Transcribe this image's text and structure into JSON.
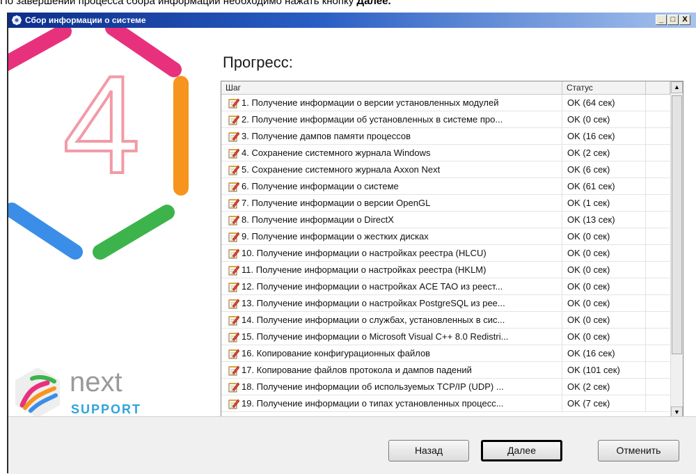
{
  "caption": {
    "text": "По завершении процесса сбора информации необходимо нажать кнопку ",
    "bold": "Далее."
  },
  "window": {
    "title": "Сбор информации о системе",
    "minimize": "_",
    "maximize": "□",
    "close": "X"
  },
  "sidebar": {
    "logo_word": "next",
    "logo_sub": "SUPPORT",
    "big_number": "4"
  },
  "progress": {
    "title": "Прогресс:"
  },
  "table": {
    "headers": {
      "step": "Шаг",
      "status": "Статус"
    },
    "rows": [
      {
        "step": "1. Получение информации о версии установленных модулей",
        "status": "OK (64 сек)"
      },
      {
        "step": "2. Получение информации об установленных в системе про...",
        "status": "OK (0 сек)"
      },
      {
        "step": "3. Получение дампов памяти процессов",
        "status": "OK (16 сек)"
      },
      {
        "step": "4. Сохранение системного журнала Windows",
        "status": "OK (2 сек)"
      },
      {
        "step": "5. Сохранение системного журнала Axxon Next",
        "status": "OK (6 сек)"
      },
      {
        "step": "6. Получение информации о системе",
        "status": "OK (61 сек)"
      },
      {
        "step": "7. Получение информации о версии OpenGL",
        "status": "OK (1 сек)"
      },
      {
        "step": "8. Получение информации о DirectX",
        "status": "OK (13 сек)"
      },
      {
        "step": "9. Получение информации о жестких дисках",
        "status": "OK (0 сек)"
      },
      {
        "step": "10. Получение информации о настройках реестра (HLCU)",
        "status": "OK (0 сек)"
      },
      {
        "step": "11. Получение информации о настройках реестра (HKLM)",
        "status": "OK (0 сек)"
      },
      {
        "step": "12. Получение информации о настройках ACE TAO из реест...",
        "status": "OK (0 сек)"
      },
      {
        "step": "13. Получение информации о настройках PostgreSQL из рее...",
        "status": "OK (0 сек)"
      },
      {
        "step": "14. Получение информации о службах, установленных в сис...",
        "status": "OK (0 сек)"
      },
      {
        "step": "15. Получение информации о Microsoft Visual C++ 8.0 Redistri...",
        "status": "OK (0 сек)"
      },
      {
        "step": "16. Копирование конфигурационных файлов",
        "status": "OK (16 сек)"
      },
      {
        "step": "17. Копирование файлов протокола и дампов падений",
        "status": "OK (101 сек)"
      },
      {
        "step": "18. Получение информации об используемых TCP/IP (UDP) ...",
        "status": "OK (2 сек)"
      },
      {
        "step": "19. Получение информации о типах установленных процесс...",
        "status": "OK (7 сек)"
      }
    ]
  },
  "buttons": {
    "back": "Назад",
    "next": "Далее",
    "cancel": "Отменить"
  },
  "colors": {
    "titlebar_start": "#0c2e8a",
    "titlebar_end": "#a8c4ee",
    "hex_pink": "#e8317d",
    "hex_orange": "#f7941d",
    "hex_green": "#3cb44b",
    "hex_blue": "#3a8ee8",
    "number_pink": "#f29aa6",
    "support_blue": "#2ea3dc"
  }
}
